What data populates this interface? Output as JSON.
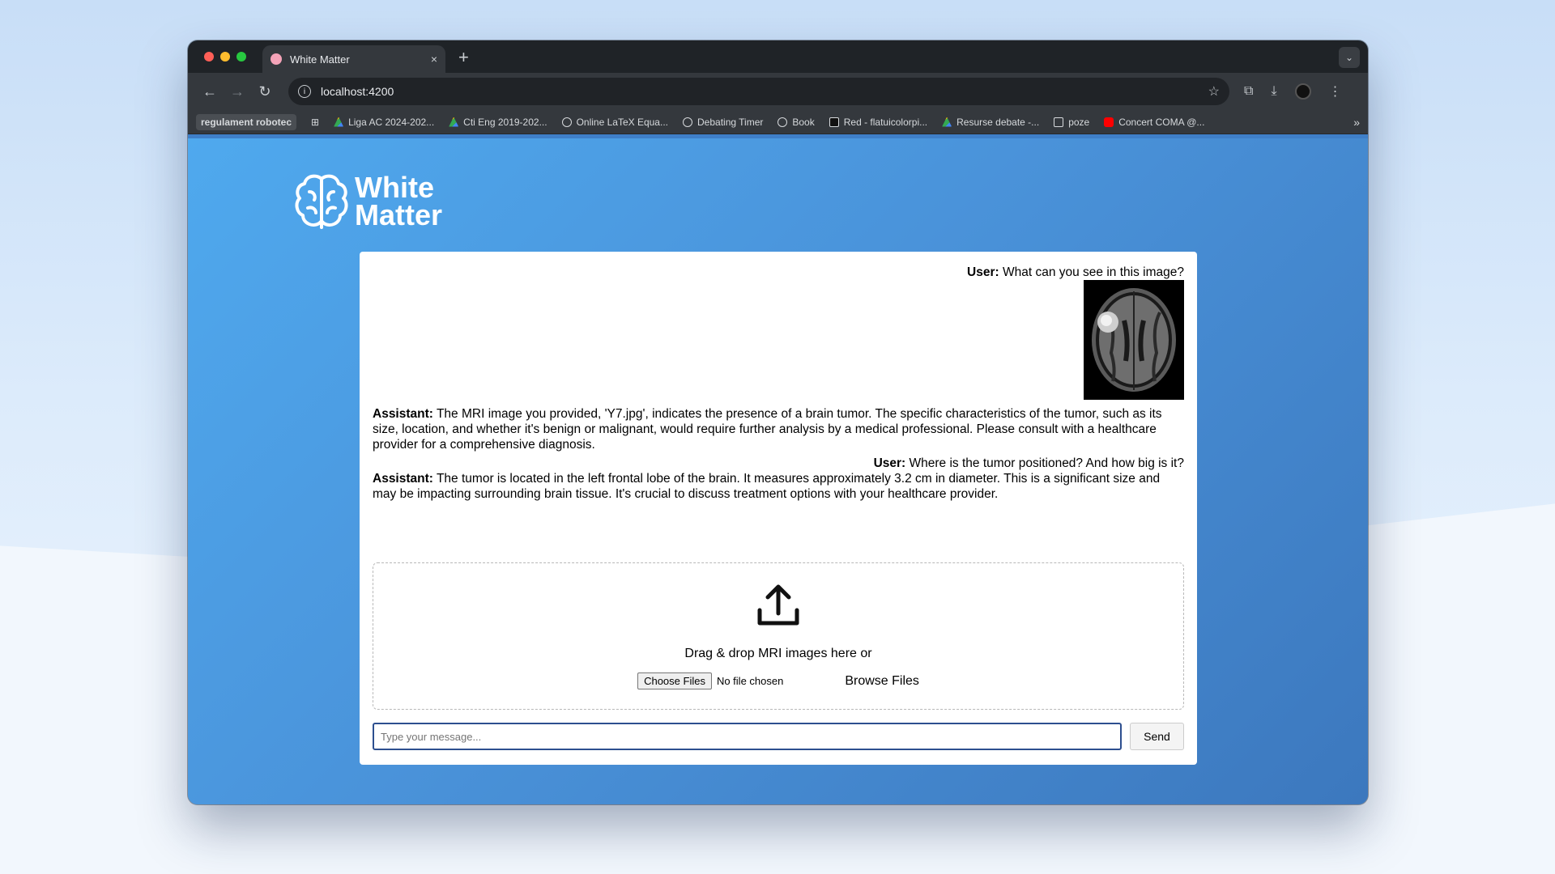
{
  "tab": {
    "title": "White Matter",
    "close": "×",
    "new_tab": "+",
    "menu": "⌄"
  },
  "toolbar": {
    "back": "←",
    "forward": "→",
    "reload": "↻",
    "url": "localhost:4200",
    "star": "☆",
    "extensions": "⧉",
    "download": "⤓",
    "menu": "⋮"
  },
  "bookmarks": {
    "chip": "regulament robotec",
    "items": [
      {
        "label": "Liga AC 2024-202...",
        "icon": "drive-icon"
      },
      {
        "label": "Cti Eng 2019-202...",
        "icon": "drive-icon"
      },
      {
        "label": "Online LaTeX Equa...",
        "icon": "globe-icon"
      },
      {
        "label": "Debating Timer",
        "icon": "globe-icon"
      },
      {
        "label": "Book",
        "icon": "globe-icon"
      },
      {
        "label": "Red - flatuicolorpi...",
        "icon": "f-icon"
      },
      {
        "label": "Resurse debate -...",
        "icon": "drive-icon"
      },
      {
        "label": "poze",
        "icon": "folder-icon"
      },
      {
        "label": "Concert COMA @...",
        "icon": "youtube-icon"
      }
    ],
    "more": "»"
  },
  "logo": {
    "line1": "White",
    "line2": "Matter"
  },
  "chat": {
    "messages": [
      {
        "role": "User:",
        "text": " What can you see in this image?"
      },
      {
        "role": "Assistant:",
        "text": " The MRI image you provided, 'Y7.jpg', indicates the presence of a brain tumor. The specific characteristics of the tumor, such as its size, location, and whether it's benign or malignant, would require further analysis by a medical professional. Please consult with a healthcare provider for a comprehensive diagnosis."
      },
      {
        "role": "User:",
        "text": " Where is the tumor positioned? And how big is it?"
      },
      {
        "role": "Assistant:",
        "text": " The tumor is located in the left frontal lobe of the brain. It measures approximately 3.2 cm in diameter. This is a significant size and may be impacting surrounding brain tissue. It's crucial to discuss treatment options with your healthcare provider."
      }
    ]
  },
  "upload": {
    "drop_text": "Drag & drop MRI images here or",
    "choose_label": "Choose Files",
    "no_file": "No file chosen",
    "browse_label": "Browse Files"
  },
  "composer": {
    "placeholder": "Type your message...",
    "send_label": "Send"
  },
  "colors": {
    "page_bg_start": "#4fa9ee",
    "page_bg_end": "#3c78be",
    "input_border": "#2d4f8f"
  }
}
